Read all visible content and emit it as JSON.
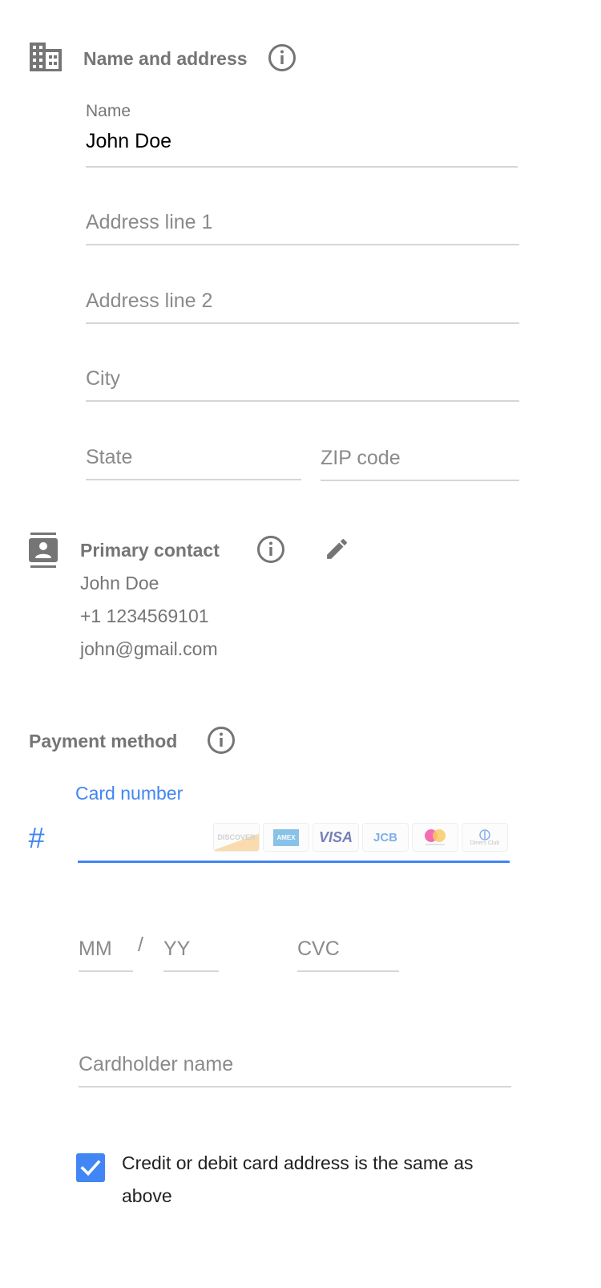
{
  "name_address": {
    "title": "Name and address",
    "icon": "building-icon",
    "info_icon": "info-icon",
    "name": {
      "label": "Name",
      "value": "John Doe"
    },
    "address_line_1": {
      "placeholder": "Address line 1"
    },
    "address_line_2": {
      "placeholder": "Address line 2"
    },
    "city": {
      "placeholder": "City"
    },
    "state": {
      "placeholder": "State"
    },
    "zip": {
      "placeholder": "ZIP code"
    }
  },
  "primary_contact": {
    "title": "Primary contact",
    "icon": "contact-card-icon",
    "info_icon": "info-icon",
    "edit_icon": "pencil-icon",
    "name": "John Doe",
    "phone": "+1 1234569101",
    "email": "john@gmail.com"
  },
  "payment_method": {
    "title": "Payment method",
    "info_icon": "info-icon",
    "card_number": {
      "label": "Card number",
      "prefix_icon": "hash-icon",
      "value": ""
    },
    "card_logos": [
      "DISCOVER",
      "AMEX",
      "VISA",
      "JCB",
      "mastercard",
      "Diners Club"
    ],
    "expiry_month": {
      "placeholder": "MM"
    },
    "expiry_separator": "/",
    "expiry_year": {
      "placeholder": "YY"
    },
    "cvc": {
      "placeholder": "CVC"
    },
    "cardholder": {
      "placeholder": "Cardholder name"
    },
    "same_address": {
      "checked": true,
      "label": "Credit or debit card address is the same as above"
    }
  },
  "colors": {
    "accent": "#4285f4",
    "muted": "#757575",
    "underline": "#d6d6d6"
  }
}
